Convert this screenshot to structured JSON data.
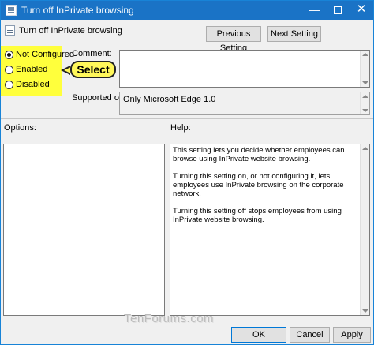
{
  "window": {
    "title": "Turn off InPrivate browsing",
    "minimize_label": "—",
    "close_label": "✕"
  },
  "header": {
    "setting_title": "Turn off InPrivate browsing",
    "previous_button_label": "Previous Setting",
    "next_button_label": "Next Setting"
  },
  "state": {
    "options": [
      {
        "label": "Not Configured",
        "checked": true
      },
      {
        "label": "Enabled",
        "checked": false
      },
      {
        "label": "Disabled",
        "checked": false
      }
    ],
    "highlight_color": "#ffff3c"
  },
  "callout": {
    "text": "Select"
  },
  "comment": {
    "label": "Comment:",
    "value": ""
  },
  "supported_on": {
    "label": "Supported on:",
    "value": "Only Microsoft Edge 1.0"
  },
  "options_panel": {
    "label": "Options:"
  },
  "help_panel": {
    "label": "Help:",
    "paragraphs": [
      "This setting lets you decide whether employees can browse using InPrivate website browsing.",
      "Turning this setting on, or not configuring it, lets employees use InPrivate browsing on the corporate network.",
      "Turning this setting off stops employees from using InPrivate website browsing."
    ]
  },
  "footer": {
    "watermark": "TenForums.com",
    "ok_label": "OK",
    "cancel_label": "Cancel",
    "apply_label": "Apply"
  },
  "colors": {
    "titlebar": "#1a73c6",
    "accent_border": "#0078d7"
  }
}
